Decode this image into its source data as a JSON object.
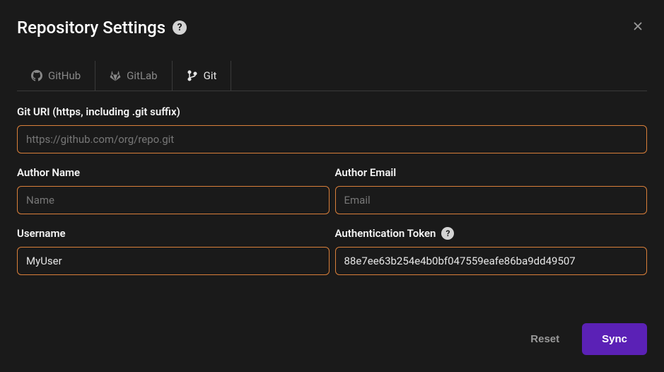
{
  "header": {
    "title": "Repository Settings"
  },
  "tabs": {
    "github": "GitHub",
    "gitlab": "GitLab",
    "git": "Git"
  },
  "form": {
    "git_uri": {
      "label": "Git URI (https, including .git suffix)",
      "placeholder": "https://github.com/org/repo.git",
      "value": ""
    },
    "author_name": {
      "label": "Author Name",
      "placeholder": "Name",
      "value": ""
    },
    "author_email": {
      "label": "Author Email",
      "placeholder": "Email",
      "value": ""
    },
    "username": {
      "label": "Username",
      "placeholder": "",
      "value": "MyUser"
    },
    "auth_token": {
      "label": "Authentication Token",
      "placeholder": "",
      "value": "88e7ee63b254e4b0bf047559eafe86ba9dd49507"
    }
  },
  "footer": {
    "reset": "Reset",
    "sync": "Sync"
  }
}
